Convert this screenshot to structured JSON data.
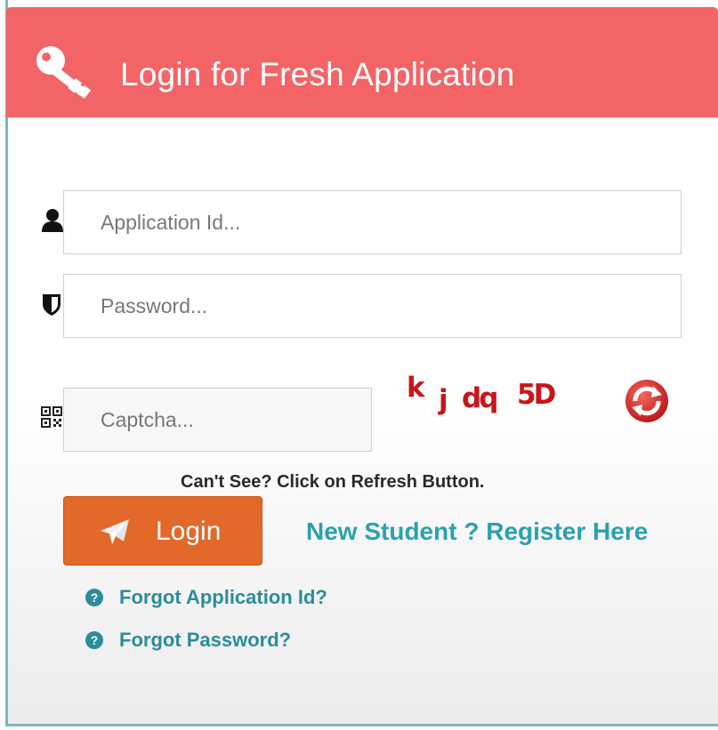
{
  "header": {
    "title": "Login for Fresh Application",
    "icon": "key-icon"
  },
  "form": {
    "application_id": {
      "placeholder": "Application Id...",
      "value": "",
      "icon": "user-icon"
    },
    "password": {
      "placeholder": "Password...",
      "value": "",
      "icon": "shield-icon"
    },
    "captcha": {
      "placeholder": "Captcha...",
      "value": "",
      "icon": "qrcode-icon"
    },
    "captcha_image": {
      "part1": "k",
      "part2": "j",
      "part3": "dq",
      "part4": "5D"
    },
    "refresh_icon": "refresh-icon",
    "hint": "Can't See? Click on Refresh Button."
  },
  "actions": {
    "login_label": "Login",
    "login_icon": "paper-plane-icon",
    "register_label": "New Student ? Register Here",
    "forgot_app_id": "Forgot Application Id?",
    "forgot_password": "Forgot Password?",
    "help_icon": "question-circle-icon"
  },
  "colors": {
    "header_bg": "#f36467",
    "login_btn": "#e2692a",
    "link": "#2aa1b0",
    "captcha": "#c8151b"
  }
}
